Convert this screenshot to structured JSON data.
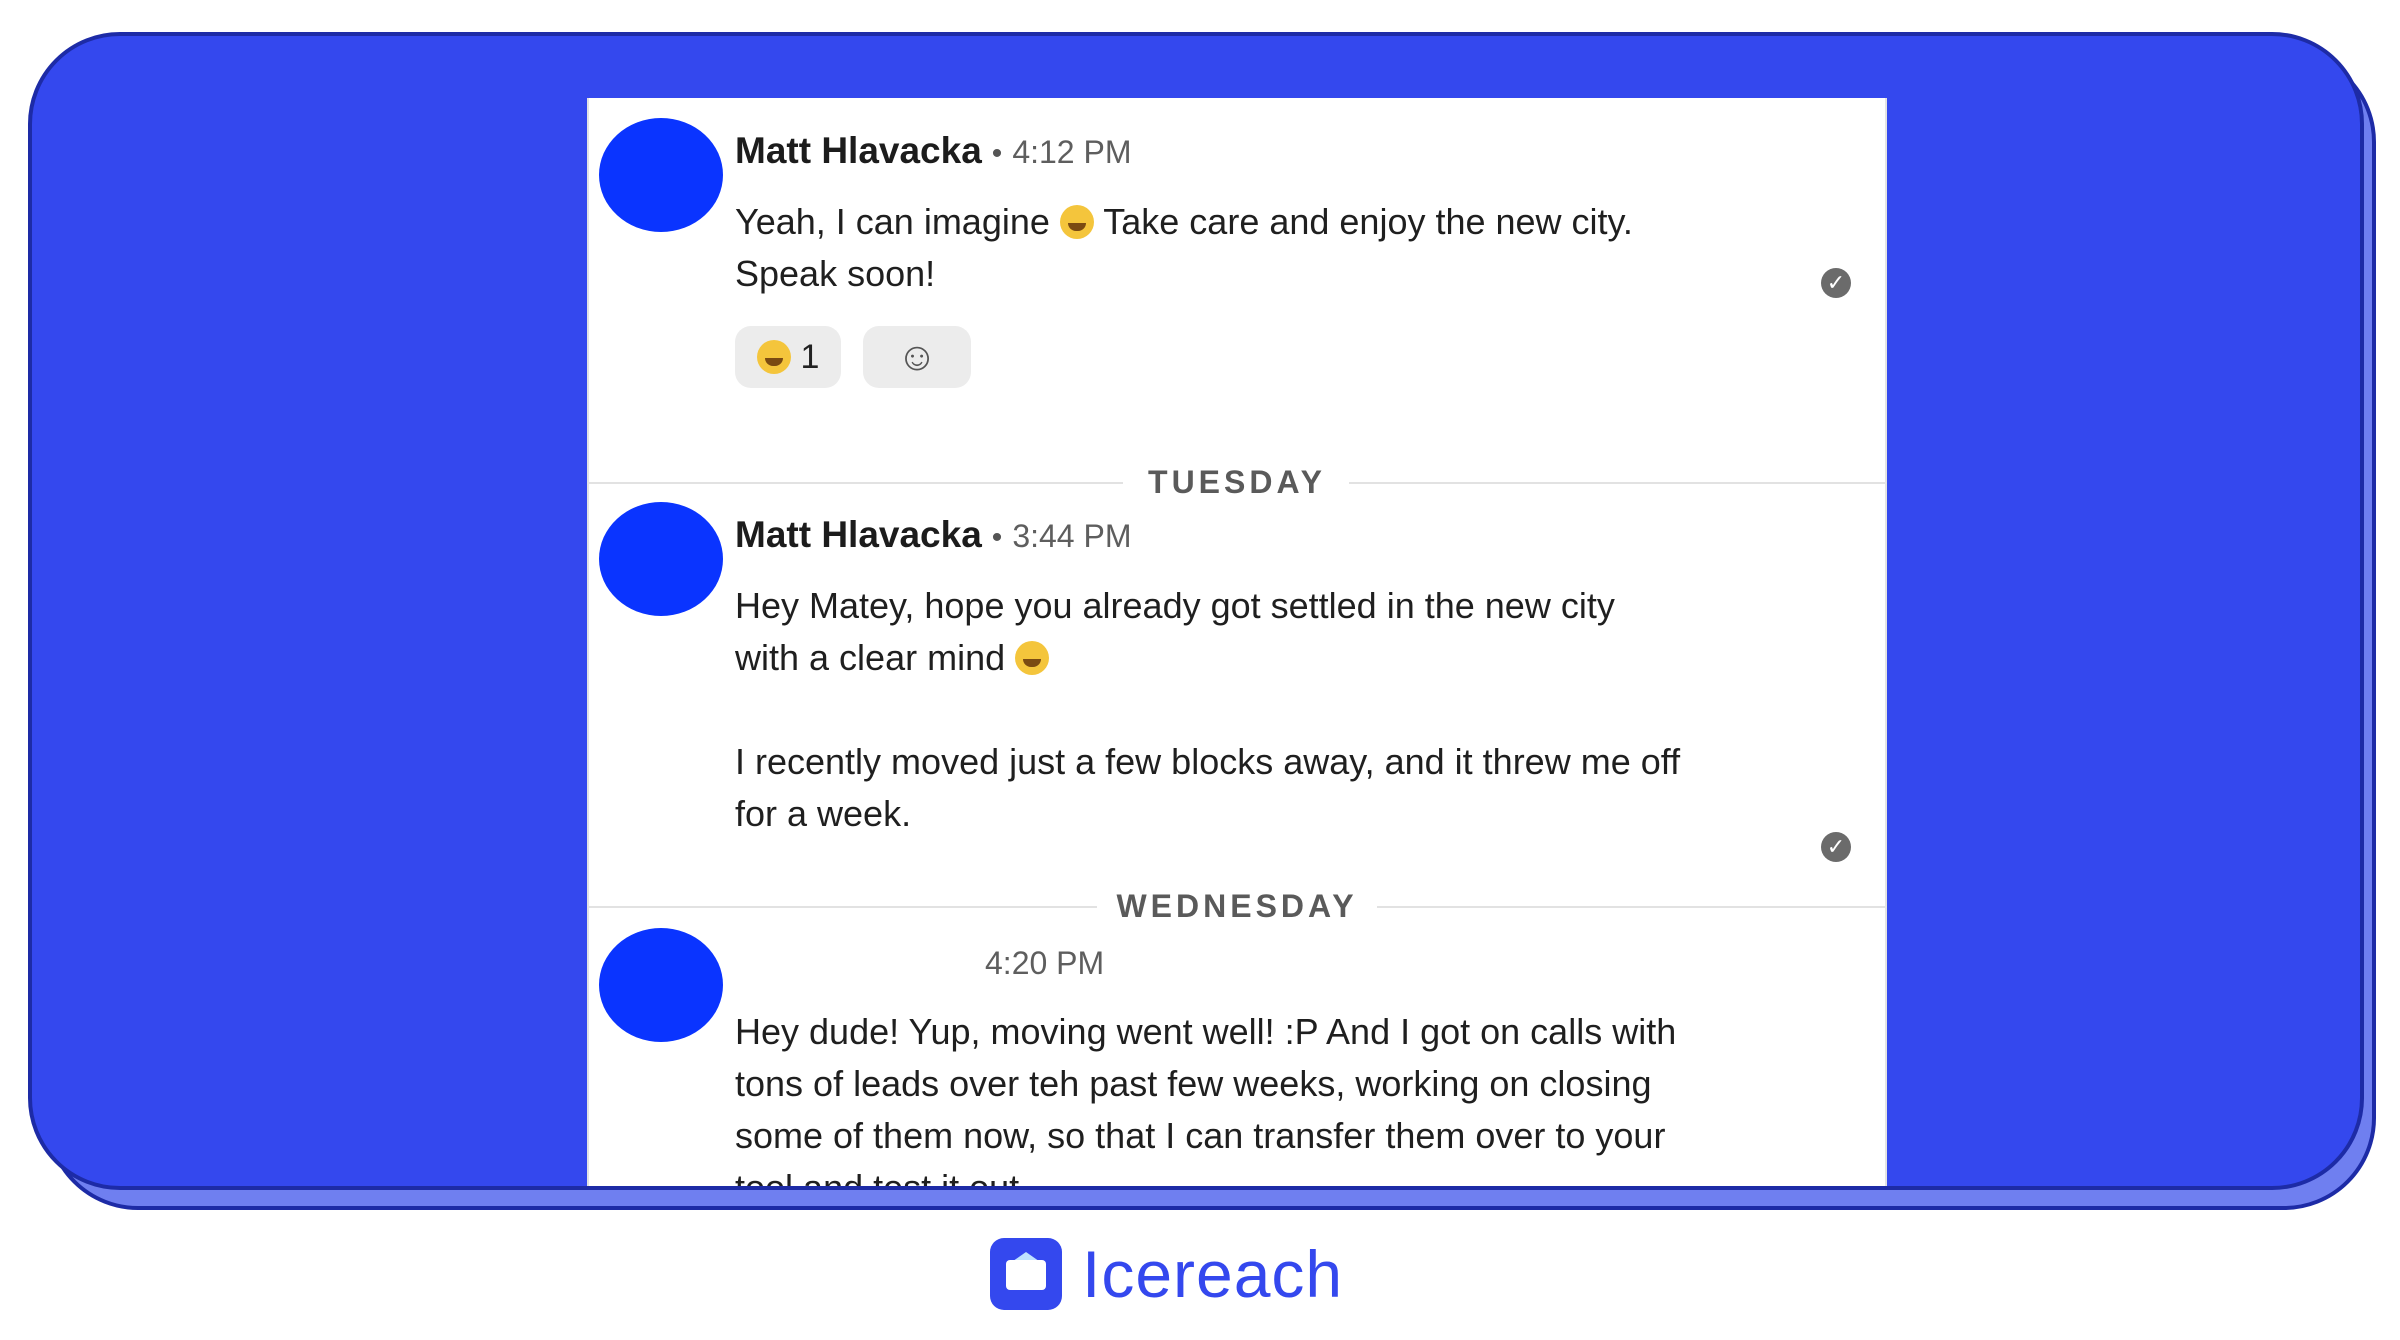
{
  "messages": [
    {
      "name": "Matt Hlavacka",
      "time": "4:12 PM",
      "text_a": "Yeah, I can imagine ",
      "text_b": " Take care and enjoy the new city.\nSpeak soon!",
      "reaction_count": "1"
    },
    {
      "name": "Matt Hlavacka",
      "time": "3:44 PM",
      "text_a": "Hey Matey, hope you already got settled in the new city\nwith a clear mind ",
      "text_b": "\n\nI recently moved just a few blocks away, and it threw me off\nfor a week."
    },
    {
      "name": "",
      "time": "4:20 PM",
      "text_a": "Hey dude! Yup, moving went well! :P And I got on calls with\ntons of leads over teh past few weeks, working on closing\nsome of them now, so that I can transfer them over to your\ntool and test it out."
    }
  ],
  "dividers": [
    "TUESDAY",
    "WEDNESDAY"
  ],
  "brand": {
    "name": "Icereach",
    "color": "#3448ee"
  },
  "colors": {
    "frame": "#3448ee",
    "avatar": "#0a34ff"
  },
  "icons": [
    "read-check-icon",
    "add-reaction-icon",
    "grinning-emoji-icon",
    "envelope-logo-icon"
  ]
}
